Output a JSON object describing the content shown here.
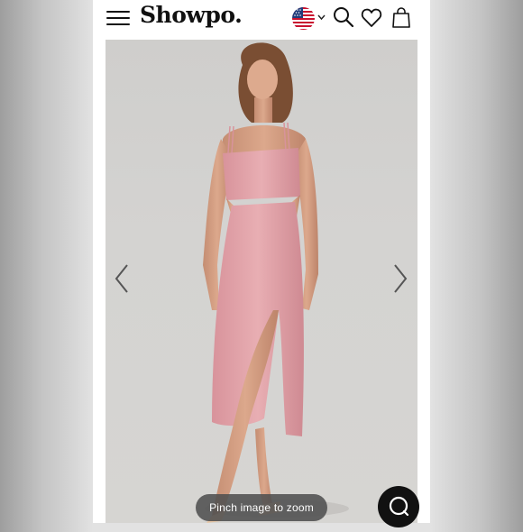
{
  "header": {
    "logo": "Showpo.",
    "menu_icon": "hamburger-menu-icon",
    "flag_icon": "us-flag-icon",
    "search_icon": "search-icon",
    "wishlist_icon": "heart-icon",
    "bag_icon": "shopping-bag-icon"
  },
  "product_image": {
    "description_icon": "product-photo",
    "prev_icon": "chevron-left-icon",
    "next_icon": "chevron-right-icon",
    "zoom_hint": "Pinch image to zoom"
  },
  "chat": {
    "icon": "chat-bubble-icon"
  },
  "colors": {
    "dress": "#e2a3a9",
    "background": "#d4d3d1",
    "header_bg": "#ffffff",
    "pinch_bg": "#505050"
  }
}
